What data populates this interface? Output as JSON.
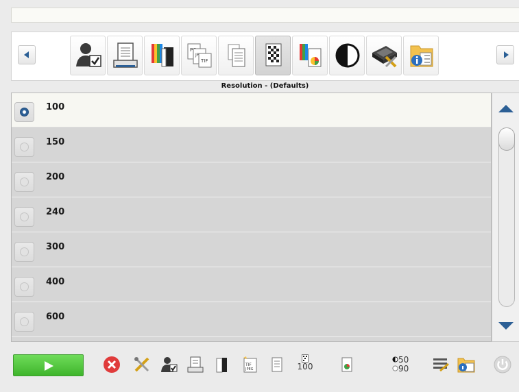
{
  "section": {
    "title": "Resolution - (Defaults)"
  },
  "resolutions": [
    {
      "label": "100",
      "selected": true
    },
    {
      "label": "150",
      "selected": false
    },
    {
      "label": "200",
      "selected": false
    },
    {
      "label": "240",
      "selected": false
    },
    {
      "label": "300",
      "selected": false
    },
    {
      "label": "400",
      "selected": false
    },
    {
      "label": "600",
      "selected": false
    }
  ],
  "toolbar": {
    "tools": [
      "user-settings-icon",
      "printer-icon",
      "color-pages-icon",
      "file-format-icon",
      "document-stack-icon",
      "resolution-icon",
      "color-profile-icon",
      "contrast-icon",
      "scanner-tools-icon",
      "info-folder-icon"
    ],
    "selected_tool": "resolution-icon"
  },
  "bottombar": {
    "resolution_value": "100",
    "brightness_value": "50",
    "contrast_value": "90"
  },
  "colors": {
    "accent": "#2c5f95",
    "start_green": "#4cc236",
    "cancel_red": "#e03b3b",
    "folder_yellow": "#f2c14e",
    "info_blue": "#2c6fbf"
  }
}
